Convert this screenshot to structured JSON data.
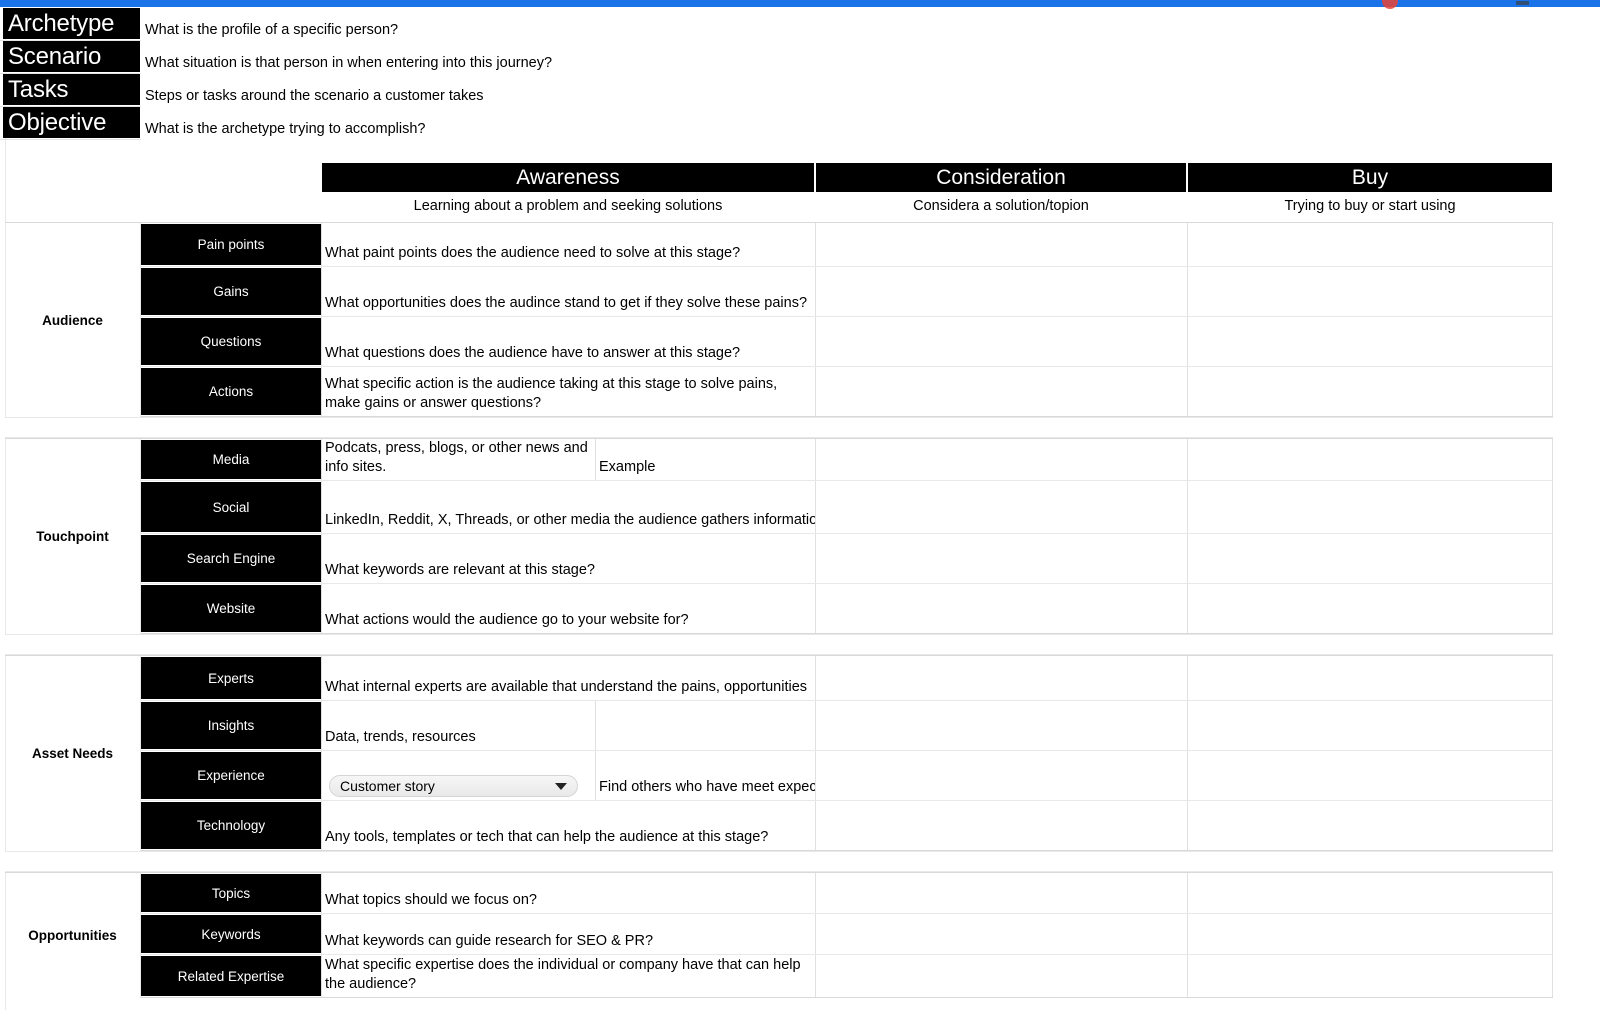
{
  "browser": {
    "accent_color": "#1a73e8",
    "marker_color": "#ea4335"
  },
  "meta": {
    "rows": [
      {
        "label": "Archetype",
        "description": "What is the profile of a specific person?"
      },
      {
        "label": "Scenario",
        "description": "What situation is that person in when entering into this journey?"
      },
      {
        "label": "Tasks",
        "description": "Steps or tasks around the scenario a customer takes"
      },
      {
        "label": "Objective",
        "description": "What is the archetype trying to accomplish?"
      }
    ]
  },
  "stages": [
    {
      "name": "Awareness",
      "subtitle": "Learning about a problem and seeking solutions"
    },
    {
      "name": "Consideration",
      "subtitle": "Considera a solution/topion"
    },
    {
      "name": "Buy",
      "subtitle": "Trying to buy or start using"
    }
  ],
  "sections": [
    {
      "name": "Audience",
      "rows": [
        {
          "label": "Pain points",
          "awareness": "What paint points does the audience need to solve at this stage?",
          "consideration": "",
          "buy": ""
        },
        {
          "label": "Gains",
          "awareness": "What opportunities does the audince stand to get if they solve these pains?",
          "consideration": "",
          "buy": ""
        },
        {
          "label": "Questions",
          "awareness": "What questions does the audience have to answer at this stage?",
          "consideration": "",
          "buy": ""
        },
        {
          "label": "Actions",
          "awareness": "What specific action is the audience taking at this stage to solve pains, make gains or answer questions?",
          "consideration": "",
          "buy": ""
        }
      ]
    },
    {
      "name": "Touchpoint",
      "rows": [
        {
          "label": "Media",
          "awareness": "Podcats, press, blogs, or other news and info sites.",
          "awareness_b": "Example",
          "split": true,
          "consideration": "",
          "buy": ""
        },
        {
          "label": "Social",
          "awareness": "LinkedIn, Reddit, X, Threads, or other media the audience gathers information at this stage.",
          "consideration": "",
          "buy": ""
        },
        {
          "label": "Search Engine",
          "awareness": "What keywords are relevant at this stage?",
          "consideration": "",
          "buy": ""
        },
        {
          "label": "Website",
          "awareness": "What actions would the audience go to your website for?",
          "consideration": "",
          "buy": ""
        }
      ]
    },
    {
      "name": "Asset Needs",
      "rows": [
        {
          "label": "Experts",
          "awareness": "What internal experts are available that understand the pains, opportunities",
          "consideration": "",
          "buy": ""
        },
        {
          "label": "Insights",
          "awareness": "Data, trends, resources",
          "awareness_b": "",
          "split": true,
          "consideration": "",
          "buy": ""
        },
        {
          "label": "Experience",
          "dropdown_value": "Customer story",
          "awareness_b": "Find others who have meet expectations",
          "split": true,
          "consideration": "",
          "buy": ""
        },
        {
          "label": "Technology",
          "awareness": "Any tools, templates or tech that can help the audience at this stage?",
          "consideration": "",
          "buy": ""
        }
      ]
    },
    {
      "name": "Opportunities",
      "rows": [
        {
          "label": "Topics",
          "awareness": "What topics should we focus on?",
          "consideration": "",
          "buy": ""
        },
        {
          "label": "Keywords",
          "awareness": "What keywords can guide research for SEO & PR?",
          "consideration": "",
          "buy": ""
        },
        {
          "label": "Related Expertise",
          "awareness": "What specific expertise does the individual or company have that can help the audience?",
          "consideration": "",
          "buy": ""
        }
      ]
    }
  ]
}
